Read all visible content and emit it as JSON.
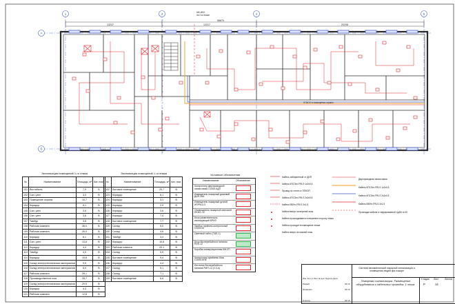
{
  "colors": {
    "wall": "#2b2b2b",
    "device": "#e3262b",
    "cable_fire": "#e3262b",
    "cable_orange": "#f29b1d",
    "cable_blue": "#3a59c7",
    "window": "#4a5fd0",
    "axis": "#3a59c7"
  },
  "axes": {
    "top_numbers": [
      "1",
      "2",
      "3",
      "4",
      "5"
    ],
    "side_letters": [
      "A",
      "Б"
    ]
  },
  "dims": {
    "d1": "13237",
    "d2": "12217",
    "d3": "20208",
    "total": "55670"
  },
  "plan_notes": {
    "riser": "ШК-ИКЗ\nна 2-м этаже",
    "panel": "ППКОП\nв помещении охраны"
  },
  "rooms_table_left": {
    "caption": "Экспликация помещений 1-го этажа",
    "headers": [
      "№",
      "Наименование",
      "Площадь, м²",
      "Кат. пом."
    ],
    "rows": [
      [
        "101",
        "Вестибюль",
        "7,9",
        "Б"
      ],
      [
        "102",
        "Сан. узел",
        "3,3",
        "В"
      ],
      [
        "103",
        "Помещение охраны",
        "10,7",
        "В"
      ],
      [
        "104",
        "Коридор",
        "8,1",
        "В"
      ],
      [
        "105",
        "Сан. узел",
        "3,6",
        "В"
      ],
      [
        "106",
        "Сан. узел",
        "3,6",
        "В"
      ],
      [
        "107",
        "Тамбур",
        "3,8",
        "В"
      ],
      [
        "108",
        "Рабочая комната",
        "36,0",
        "В"
      ],
      [
        "109",
        "Рабочая комната",
        "26,0",
        "В"
      ],
      [
        "110",
        "Коридор",
        "8,1",
        "В"
      ],
      [
        "111",
        "Сан. узел",
        "13,6",
        "В"
      ],
      [
        "112",
        "Коридор",
        "4,4",
        "В"
      ],
      [
        "113",
        "Тамбур",
        "4,9",
        "В"
      ],
      [
        "114",
        "Коридор",
        "19,8",
        "В"
      ],
      [
        "115",
        "Склад электротехнических материалов",
        "9,9",
        "В"
      ],
      [
        "116",
        "Склад электротехнических материалов",
        "8,9",
        "В"
      ],
      [
        "117",
        "Рабочая комната",
        "28,1",
        "В"
      ],
      [
        "118",
        "Производственное пом.",
        "28,7",
        "В"
      ],
      [
        "119",
        "Склад электротехнических материалов",
        "29,9",
        "В"
      ],
      [
        "120",
        "Коридор",
        "4,3",
        "В"
      ],
      [
        "121",
        "Рабочая комната",
        "12,8",
        "В"
      ]
    ]
  },
  "rooms_table_right": {
    "caption": "Экспликация помещений 1-го этажа",
    "headers": [
      "№",
      "Наименование",
      "Площадь, м²",
      "Кат. пом."
    ],
    "rows": [
      [
        "122",
        "Бытовое помещение",
        "29,7",
        "В"
      ],
      [
        "123",
        "Коридор",
        "6,1",
        "В"
      ],
      [
        "124",
        "Коридор",
        "3,1",
        "В"
      ],
      [
        "125",
        "Коридор",
        "2,9",
        "В"
      ],
      [
        "126",
        "Коридор",
        "3,6",
        "В"
      ],
      [
        "127",
        "Коридор",
        "7,4",
        "В"
      ],
      [
        "128",
        "Бытовое помещение",
        "7,7",
        "В"
      ],
      [
        "129",
        "Склад",
        "5,0",
        "В"
      ],
      [
        "130",
        "Склад",
        "4,6",
        "В"
      ],
      [
        "131",
        "Тамбур",
        "3,3",
        "В"
      ],
      [
        "132",
        "Коридор",
        "10,6",
        "В"
      ],
      [
        "133",
        "Рабочая комната",
        "20,1",
        "В"
      ],
      [
        "134",
        "Склад",
        "5,9",
        "В"
      ],
      [
        "135",
        "Бытовое помещение",
        "9,4",
        "В"
      ],
      [
        "136",
        "Коридор",
        "4,4",
        "В"
      ],
      [
        "137",
        "Склад",
        "5,1",
        "В"
      ],
      [
        "138",
        "Склад",
        "7,1",
        "В"
      ],
      [
        "139",
        "Бытовое помещение",
        "6,6",
        "В"
      ]
    ]
  },
  "legend": {
    "title": "Условные обозначения",
    "header_name": "Наименование",
    "header_symbol": "Обозначение",
    "items": [
      "Контроллер двухпроводной линии связи С2000-КДЛ",
      "Извещатель пожарный дымовой ДИП-34А",
      "Извещатель пожарный ручной ИПР513-3",
      "Оповещатель пожарный световой ЛЮКС-12",
      "Блок разветвительно-изолирующий БРИЗ",
      "Прибор приёмно-контрольный С2000-М",
      "Световой табло (ТАБ-1)",
      "Блок бесперебойного питания РИП-12",
      "Коробка коммутационная КМ-2П",
      "Контроллер-приёмник блок С2000-КПБ",
      "Источник бесперебойного питания РИП-12 (2.3 А)"
    ]
  },
  "cable_legend": {
    "items": [
      "Кабель лабиринтный от ДИП",
      "Кабель КПСЭнг-FRLS 1х2х0,5",
      "Провод по стене от ППКОП",
      "Кабель КПСЭнг-FRLS 2х2х0,5",
      "Кабель ВВГнг-FRLS 3х1,5"
    ],
    "right_items": [
      "Двухпроводная линия связи",
      "Кабель КПСЭнг-FRLS 1х2х0,5",
      "Кабель КПСЭнг-FRLS 2х2х0,5",
      "Кабель ВВГнг-FRLS 3х1,5",
      "Прокладка кабеля в гофрированной трубе d=20"
    ],
    "notes": [
      "Кабели вверх на верхний этаж",
      "Кабель прокладывается в верхнюю сторону этажа",
      "Кабель проходит в помещение этажа",
      "Кабель вверх на нижний этаж"
    ]
  },
  "stamp": {
    "project": "Система автоматической пожарной сигнализации и оповещения людей при пожаре",
    "sheet_title": "Пожарная сигнализация. Размещение оборудования и кабельных проводок. 1 этаж.",
    "stage_label": "Стадия",
    "sheet_label": "Лист",
    "sheets_label": "Листов",
    "stage": "Р",
    "sheet": "14",
    "sheets": "",
    "roles": [
      "Разраб.",
      "Проверил",
      "",
      "Н.контр."
    ],
    "col_heads": [
      "Изм.",
      "Кол.уч",
      "Лист",
      "№ док.",
      "Подпись",
      "Дата"
    ],
    "dates": [
      "03.10",
      "03.10",
      "",
      "03.10"
    ]
  }
}
